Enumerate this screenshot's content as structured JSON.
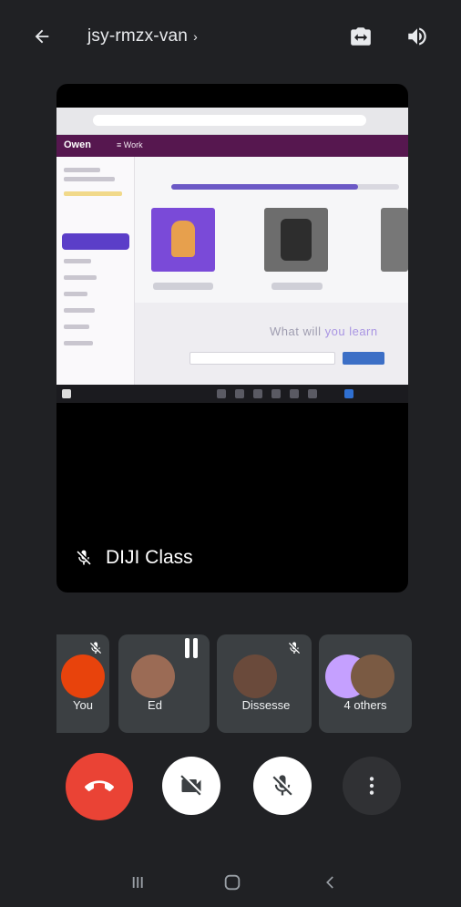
{
  "header": {
    "meeting_code": "jsy-rmzx-van",
    "title_chevron": "›",
    "back_icon": "arrow-back-icon",
    "switch_camera_icon": "switch-camera-icon",
    "speaker_icon": "speaker-volume-icon"
  },
  "presentation": {
    "presenter_name": "DIJI Class",
    "mic_state_icon": "mic-off-icon",
    "shared_screen": {
      "brand": "Owen",
      "menu_text": "≡  Work",
      "lower_text_gray": "What will ",
      "lower_text_accent": "you learn",
      "progress_fraction": 0.82
    }
  },
  "participants": [
    {
      "name": "You",
      "muted": true,
      "avatar_color": "#e8430c"
    },
    {
      "name": "Ed",
      "speaking": true,
      "avatar_color": "#9b6b55"
    },
    {
      "name": "Dissesse",
      "muted": true,
      "avatar_color": "#6a4a3b"
    },
    {
      "name": "4 others",
      "avatar_color": "#c5a0ff"
    }
  ],
  "controls": {
    "end_call_icon": "end-call-icon",
    "camera_icon": "camera-off-icon",
    "mic_icon": "mic-off-icon",
    "more_icon": "more-options-icon"
  },
  "nav": {
    "recents_icon": "recent-apps-icon",
    "home_icon": "home-icon",
    "back_icon": "back-chevron-icon"
  },
  "colors": {
    "background": "#202124",
    "end_call": "#ea4335",
    "tile": "#3c4043",
    "app_header": "#56174f"
  }
}
